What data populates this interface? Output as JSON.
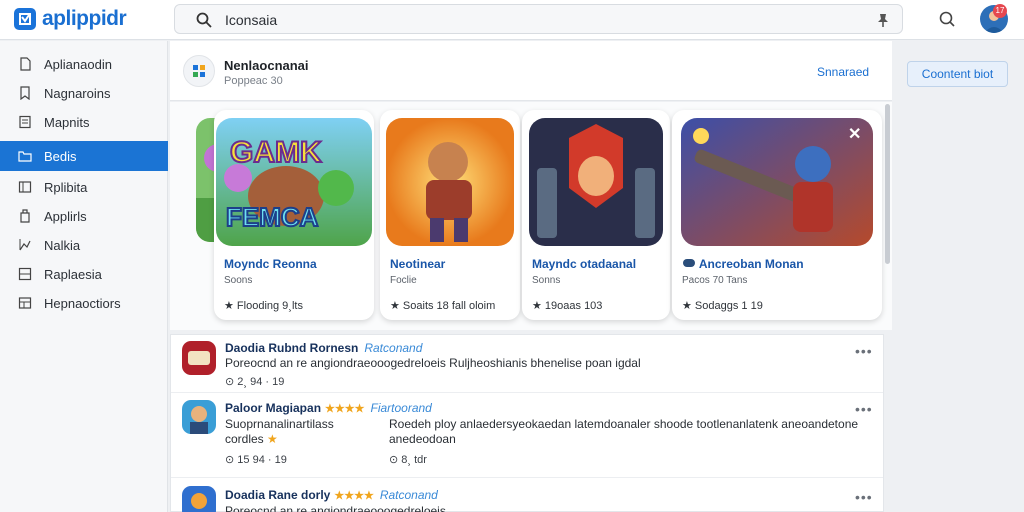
{
  "app": {
    "name": "aplippidr"
  },
  "search": {
    "value": "Iconsaia"
  },
  "header": {
    "avatar_badge": "17"
  },
  "sidebar": {
    "items": [
      {
        "label": "Aplianaodin",
        "icon": "document-icon",
        "active": false
      },
      {
        "label": "Nagnaroins",
        "icon": "bookmark-icon",
        "active": false
      },
      {
        "label": "Mapnits",
        "icon": "list-icon",
        "active": false
      },
      {
        "label": "Bedis",
        "icon": "folder-icon",
        "active": true
      },
      {
        "label": "Rplibita",
        "icon": "panel-icon",
        "active": false
      },
      {
        "label": "Applirls",
        "icon": "window-icon",
        "active": false
      },
      {
        "label": "Nalkia",
        "icon": "chart-icon",
        "active": false
      },
      {
        "label": "Raplaesia",
        "icon": "grid-icon",
        "active": false
      },
      {
        "label": "Hepnaoctiors",
        "icon": "table-icon",
        "active": false
      }
    ]
  },
  "main": {
    "title": "Nenlaocnanai",
    "subtitle": "Poppeac 30",
    "link": "Snnaraed",
    "connect_label": "Coontent biot"
  },
  "carousel": {
    "cards": [
      {
        "title": "Moyndc Reonna",
        "sub": "Soons",
        "meta": "Flooding 9¸lts",
        "art_title_1": "GAMK",
        "art_title_2": "FEMCA"
      },
      {
        "title": "Neotinear",
        "sub": "Foclie",
        "meta": "Soaits 18 fall oloim"
      },
      {
        "title": "Mayndc otadaanal",
        "sub": "Sonns",
        "meta": "19oaas 103"
      },
      {
        "title": "Ancreoban Monan",
        "sub": "Pacos 70 Tans",
        "meta": "Sodaggs 1 19"
      }
    ]
  },
  "list": {
    "rows": [
      {
        "title": "Daodia Rubnd Rornesn",
        "tag": "Ratconand",
        "stars": "",
        "desc": "Poreocnd an re angiondraeooogedreloeis  Ruljheoshianis bhenelise poan igdal",
        "meta": "2¸ 94 · 19",
        "desc_right": ""
      },
      {
        "title": "Paloor Magiapan",
        "tag": "Fiartoorand",
        "stars": "★★★★",
        "desc": "Suoprnanalinartilass",
        "desc2": "cordles",
        "meta": "15 94 · 19",
        "meta_right": "8¸ tdr",
        "desc_right": "Roedeh ploy anlaedersyeokaedan latemdoanaler shoode tootlenanlatenk aneoandetone",
        "desc_right2": "anedeodoan"
      },
      {
        "title": "Doadia Rane dorly",
        "tag": "Ratconand",
        "stars": "★★★★",
        "desc": "Poreocnd an re angiondraeooogedreloeis",
        "meta": "",
        "desc_right": ""
      }
    ]
  },
  "colors": {
    "accent": "#1b74d4",
    "link": "#1a6fd1",
    "star": "#f0a51d"
  }
}
